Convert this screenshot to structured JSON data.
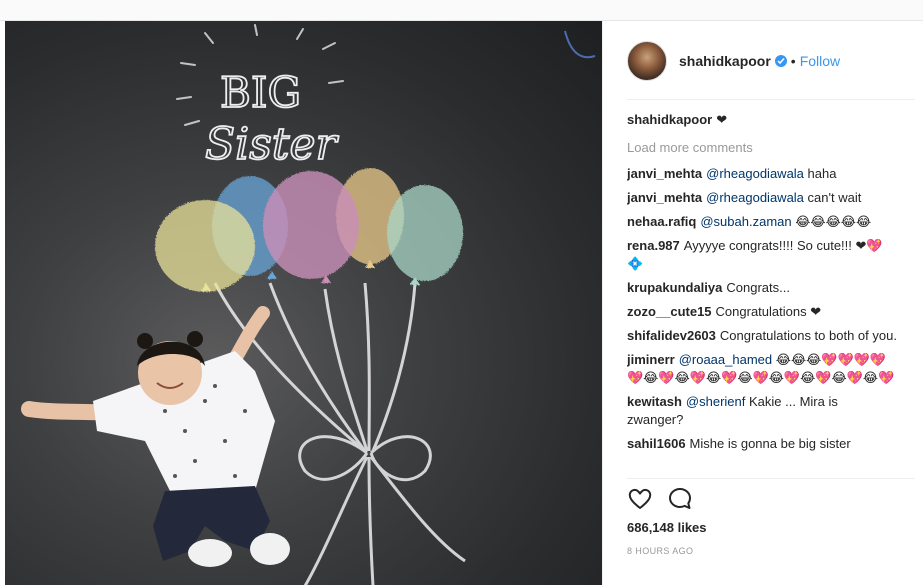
{
  "header": {
    "username": "shahidkapoor",
    "separator": "•",
    "follow_label": "Follow"
  },
  "photo": {
    "chalk_text_line1": "BIG",
    "chalk_text_line2": "Sister"
  },
  "caption": {
    "user": "shahidkapoor",
    "text": "❤"
  },
  "load_more": "Load more comments",
  "comments": [
    {
      "user": "janvi_mehta",
      "mention": "@rheagodiawala",
      "text": "haha"
    },
    {
      "user": "janvi_mehta",
      "mention": "@rheagodiawala",
      "text": "can't wait"
    },
    {
      "user": "nehaa.rafiq",
      "mention": "@subah.zaman",
      "text": "😂😂😂😂😂"
    },
    {
      "user": "rena.987",
      "mention": "",
      "text": "Ayyyye congrats!!!! So cute!!! ❤💖💠"
    },
    {
      "user": "krupakundaliya",
      "mention": "",
      "text": "Congrats..."
    },
    {
      "user": "zozo__cute15",
      "mention": "",
      "text": "Congratulations ❤"
    },
    {
      "user": "shifalidev2603",
      "mention": "",
      "text": "Congratulations to both of you."
    },
    {
      "user": "jiminerr",
      "mention": "@roaaa_hamed",
      "text": "😂😂😂💖💖💖💖💖😂💖😂💖😂💖😂💖😂💖😂💖😂💖😂💖"
    },
    {
      "user": "kewitash",
      "mention": "@sherienf",
      "text": "Kakie ... Mira is zwanger?"
    },
    {
      "user": "sahil1606",
      "mention": "",
      "text": "Mishe is gonna be big sister"
    }
  ],
  "likes": "686,148 likes",
  "time": "8 HOURS AGO",
  "icons": {
    "like": "heart-outline-icon",
    "comment": "speech-bubble-icon",
    "verified": "verified-badge-icon"
  },
  "colors": {
    "link": "#3897f0",
    "mention": "#003569",
    "muted": "#999999",
    "balloon_yellow": "#e8e29a",
    "balloon_blue": "#6aa6d8",
    "balloon_pink": "#c98fb9",
    "balloon_orange": "#e9c98a",
    "balloon_teal": "#a9d6c6"
  }
}
